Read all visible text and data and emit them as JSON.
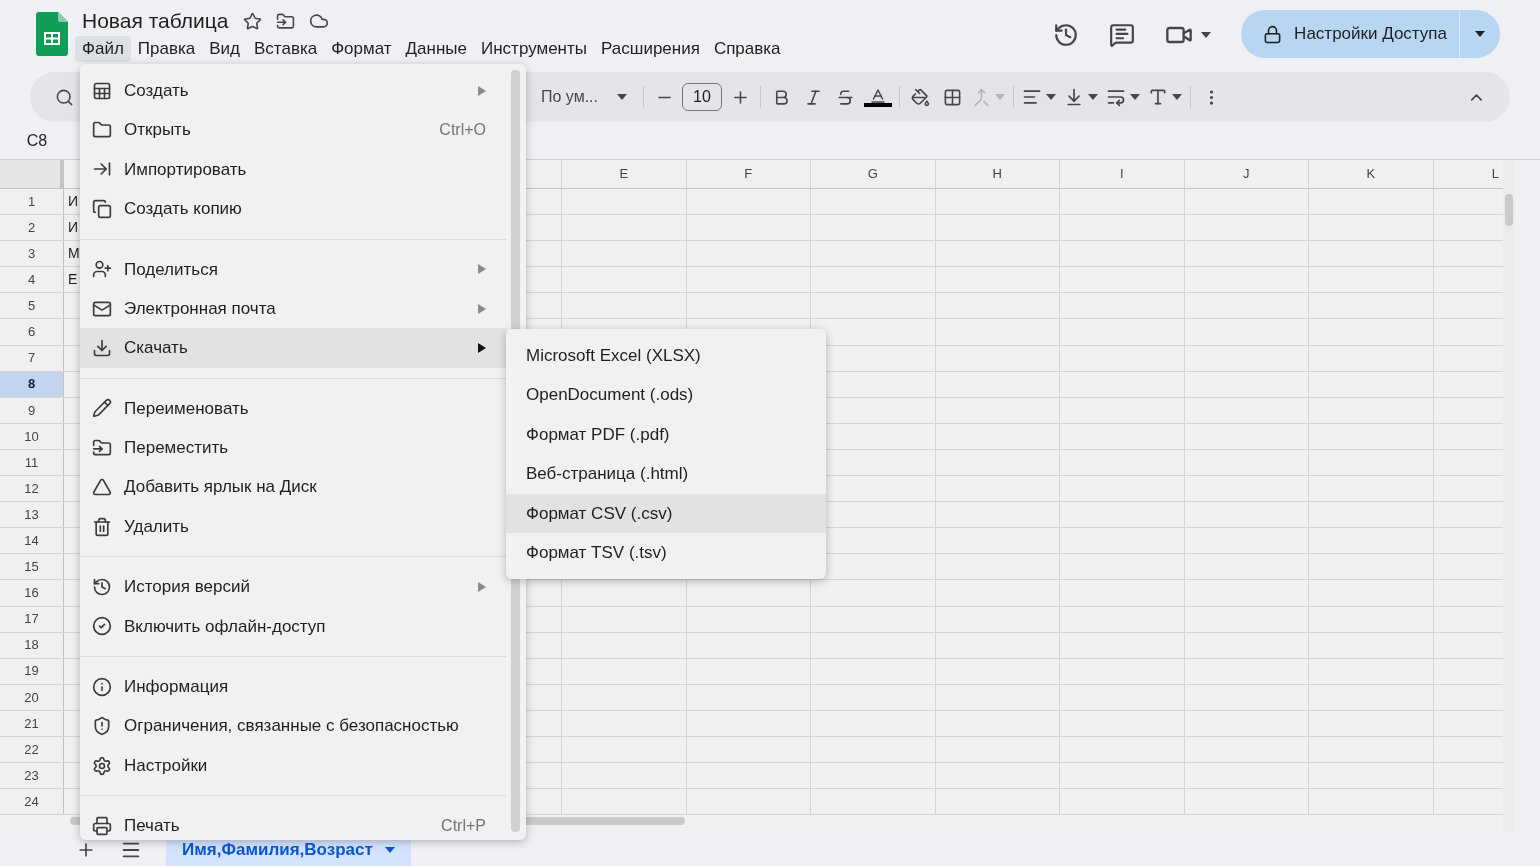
{
  "app": {
    "title": "Новая таблица"
  },
  "menu_bar": [
    {
      "label": "Файл",
      "selected": true
    },
    {
      "label": "Правка",
      "selected": false
    },
    {
      "label": "Вид",
      "selected": false
    },
    {
      "label": "Вставка",
      "selected": false
    },
    {
      "label": "Формат",
      "selected": false
    },
    {
      "label": "Данные",
      "selected": false
    },
    {
      "label": "Инструменты",
      "selected": false
    },
    {
      "label": "Расширения",
      "selected": false
    },
    {
      "label": "Справка",
      "selected": false
    }
  ],
  "share_button": {
    "label": "Настройки Доступа"
  },
  "toolbar": {
    "font": "По ум...",
    "font_size": "10",
    "merge_disabled": true
  },
  "name_box": "C8",
  "grid": {
    "columns": [
      "E",
      "F",
      "G",
      "H",
      "I",
      "J",
      "K",
      "L"
    ],
    "rows": [
      {
        "label": "1",
        "selected": false,
        "cell_a": "И"
      },
      {
        "label": "2",
        "selected": false,
        "cell_a": "И"
      },
      {
        "label": "3",
        "selected": false,
        "cell_a": "М"
      },
      {
        "label": "4",
        "selected": false,
        "cell_a": "Е"
      },
      {
        "label": "5",
        "selected": false
      },
      {
        "label": "6",
        "selected": false
      },
      {
        "label": "7",
        "selected": false
      },
      {
        "label": "8",
        "selected": true
      },
      {
        "label": "9",
        "selected": false
      },
      {
        "label": "10",
        "selected": false
      },
      {
        "label": "11",
        "selected": false
      },
      {
        "label": "12",
        "selected": false
      },
      {
        "label": "13",
        "selected": false
      },
      {
        "label": "14",
        "selected": false
      },
      {
        "label": "15",
        "selected": false
      },
      {
        "label": "16",
        "selected": false
      },
      {
        "label": "17",
        "selected": false
      },
      {
        "label": "18",
        "selected": false
      },
      {
        "label": "19",
        "selected": false
      },
      {
        "label": "20",
        "selected": false
      },
      {
        "label": "21",
        "selected": false
      },
      {
        "label": "22",
        "selected": false
      },
      {
        "label": "23",
        "selected": false
      },
      {
        "label": "24",
        "selected": false
      }
    ]
  },
  "file_menu": {
    "groups": [
      [
        {
          "kind": "new",
          "label": "Создать",
          "has_submenu": true,
          "selected": false
        },
        {
          "kind": "open",
          "label": "Открыть",
          "shortcut": "Ctrl+O",
          "has_submenu": false,
          "selected": false
        },
        {
          "kind": "import",
          "label": "Импортировать",
          "has_submenu": false,
          "selected": false
        },
        {
          "kind": "copy",
          "label": "Создать копию",
          "has_submenu": false,
          "selected": false
        }
      ],
      [
        {
          "kind": "share",
          "label": "Поделиться",
          "has_submenu": true,
          "selected": false
        },
        {
          "kind": "email",
          "label": "Электронная почта",
          "has_submenu": true,
          "selected": false
        },
        {
          "kind": "download",
          "label": "Скачать",
          "has_submenu": true,
          "selected": true
        }
      ],
      [
        {
          "kind": "rename",
          "label": "Переименовать",
          "has_submenu": false,
          "selected": false
        },
        {
          "kind": "move",
          "label": "Переместить",
          "has_submenu": false,
          "selected": false
        },
        {
          "kind": "shortcut",
          "label": "Добавить ярлык на Диск",
          "has_submenu": false,
          "selected": false
        },
        {
          "kind": "delete",
          "label": "Удалить",
          "has_submenu": false,
          "selected": false
        }
      ],
      [
        {
          "kind": "history",
          "label": "История версий",
          "has_submenu": true,
          "selected": false
        },
        {
          "kind": "offline",
          "label": "Включить офлайн-доступ",
          "has_submenu": false,
          "selected": false
        }
      ],
      [
        {
          "kind": "info",
          "label": "Информация",
          "has_submenu": false,
          "selected": false
        },
        {
          "kind": "security",
          "label": "Ограничения, связанные с безопасностью",
          "has_submenu": false,
          "selected": false
        },
        {
          "kind": "settings",
          "label": "Настройки",
          "has_submenu": false,
          "selected": false
        }
      ],
      [
        {
          "kind": "print",
          "label": "Печать",
          "shortcut": "Ctrl+P",
          "has_submenu": false,
          "selected": false
        }
      ]
    ]
  },
  "download_submenu": {
    "items": [
      {
        "label": "Microsoft Excel (XLSX)",
        "selected": false
      },
      {
        "label": "OpenDocument (.ods)",
        "selected": false
      },
      {
        "label": "Формат PDF (.pdf)",
        "selected": false
      },
      {
        "label": "Веб-страница (.html)",
        "selected": false
      },
      {
        "label": "Формат CSV (.csv)",
        "selected": true
      },
      {
        "label": "Формат TSV (.tsv)",
        "selected": false
      }
    ]
  },
  "sheet_tabs": [
    {
      "label": "Имя,Фамилия,Возраст",
      "selected": true
    }
  ]
}
